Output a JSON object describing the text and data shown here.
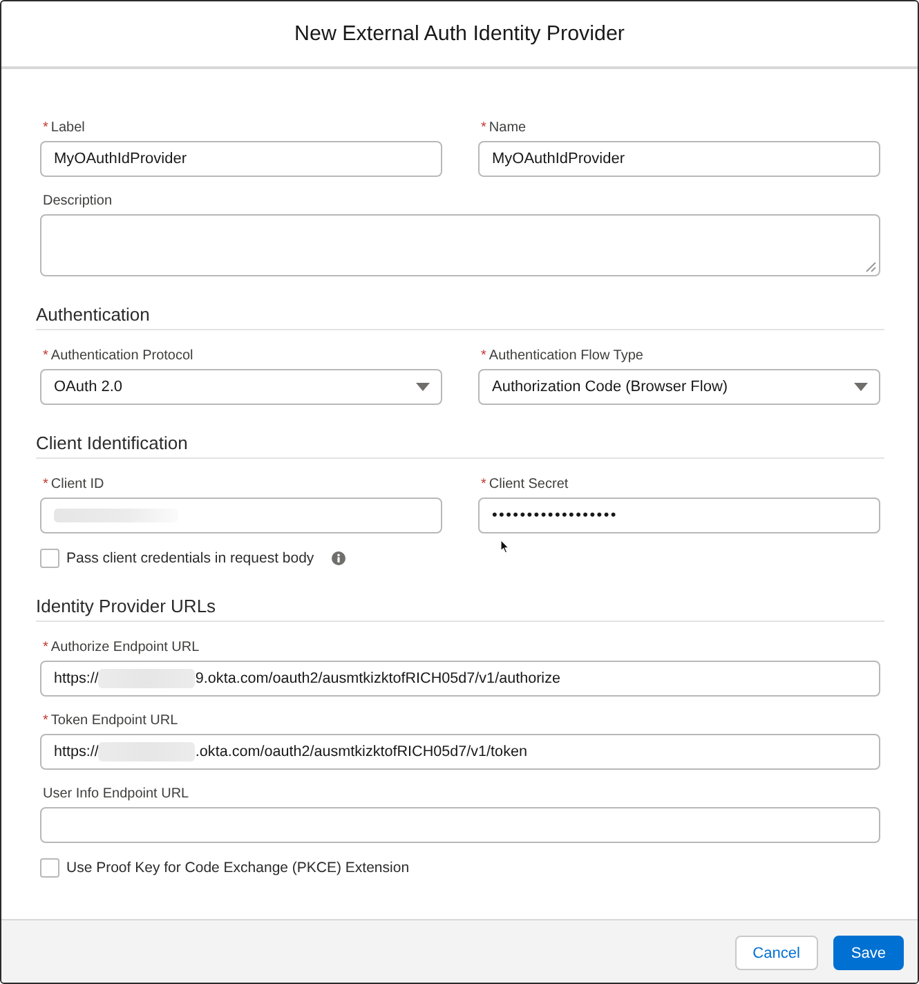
{
  "dialog": {
    "title": "New External Auth Identity Provider"
  },
  "sections": [
    {
      "rows": [
        [
          {
            "kind": "text",
            "required_mark": "*",
            "label": "Label",
            "value": "MyOAuthIdProvider"
          },
          {
            "kind": "text",
            "required_mark": "*",
            "label": "Name",
            "value": "MyOAuthIdProvider"
          }
        ],
        [
          {
            "kind": "textarea",
            "label": "Description"
          }
        ]
      ]
    },
    {
      "heading": "Authentication",
      "rows": [
        [
          {
            "kind": "select",
            "required_mark": "*",
            "label": "Authentication Protocol",
            "value": "OAuth 2.0"
          },
          {
            "kind": "select",
            "required_mark": "*",
            "label": "Authentication Flow Type",
            "value": "Authorization Code (Browser Flow)"
          }
        ]
      ]
    },
    {
      "heading": "Client Identification",
      "rows": [
        [
          {
            "kind": "text",
            "required_mark": "*",
            "label": "Client ID",
            "redacted": true
          },
          {
            "kind": "password",
            "required_mark": "*",
            "label": "Client Secret",
            "value": "••••••••••••••••••"
          }
        ],
        [
          {
            "kind": "checkbox",
            "label": "Pass client credentials in request body",
            "checked": false,
            "info": true
          }
        ]
      ]
    },
    {
      "heading": "Identity Provider URLs",
      "rows": [
        [
          {
            "kind": "text",
            "required_mark": "*",
            "label": "Authorize Endpoint URL",
            "prefix": "https://",
            "redacted": true,
            "value": "9.okta.com/oauth2/ausmtkizktofRICH05d7/v1/authorize"
          }
        ],
        [
          {
            "kind": "text",
            "required_mark": "*",
            "label": "Token Endpoint URL",
            "prefix": "https://",
            "redacted": true,
            "value": ".okta.com/oauth2/ausmtkizktofRICH05d7/v1/token"
          }
        ],
        [
          {
            "kind": "text",
            "label": "User Info Endpoint URL"
          }
        ],
        [
          {
            "kind": "checkbox",
            "label": "Use Proof Key for Code Exchange (PKCE) Extension",
            "checked": false
          }
        ]
      ]
    }
  ],
  "footer": {
    "buttons": [
      {
        "label": "Cancel",
        "kind": "neutral"
      },
      {
        "label": "Save",
        "kind": "brand"
      }
    ]
  }
}
